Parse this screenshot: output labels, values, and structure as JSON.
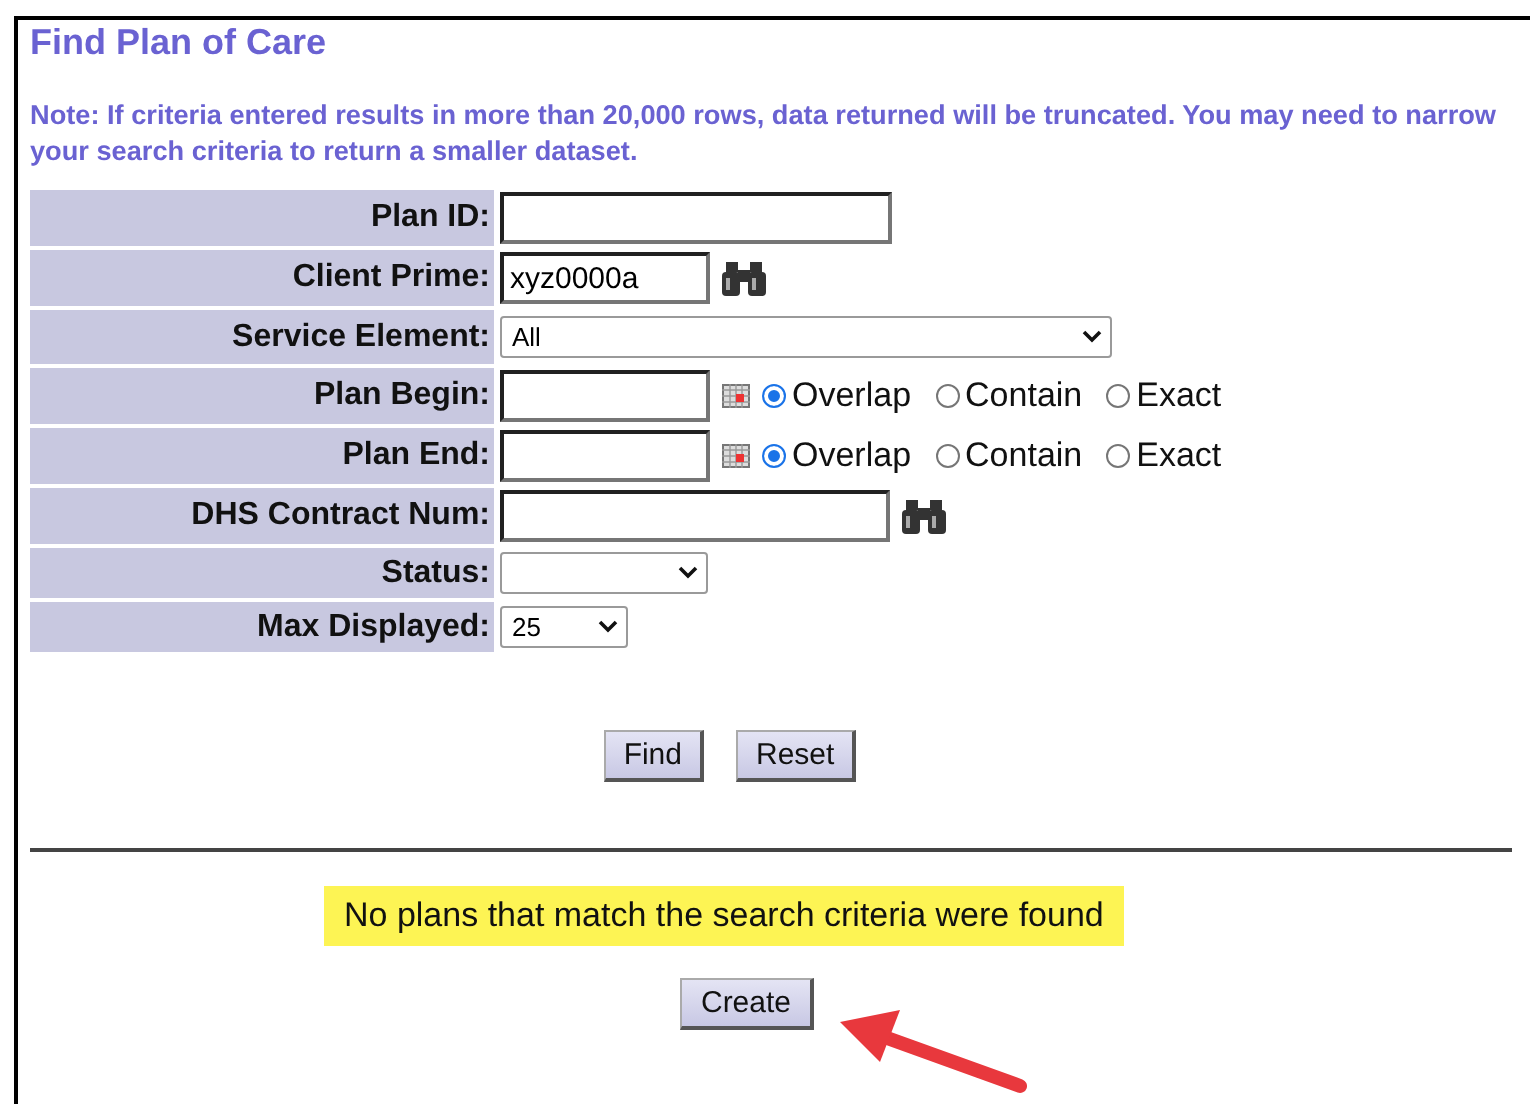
{
  "title": "Find Plan of Care",
  "note": "Note: If criteria entered results in more than 20,000 rows, data returned will be truncated. You may need to narrow your search criteria to return a smaller dataset.",
  "fields": [
    {
      "label": "Plan ID:",
      "kind": "text"
    },
    {
      "label": "Client Prime:",
      "kind": "lookup",
      "value": "xyz0000a"
    },
    {
      "label": "Service Element:",
      "kind": "select",
      "value": "All"
    },
    {
      "label": "Plan Begin:",
      "kind": "date",
      "options": [
        {
          "label": "Overlap",
          "selected": true
        },
        {
          "label": "Contain",
          "selected": false
        },
        {
          "label": "Exact",
          "selected": false
        }
      ]
    },
    {
      "label": "Plan End:",
      "kind": "date",
      "options": [
        {
          "label": "Overlap",
          "selected": true
        },
        {
          "label": "Contain",
          "selected": false
        },
        {
          "label": "Exact",
          "selected": false
        }
      ]
    },
    {
      "label": "DHS Contract Num:",
      "kind": "lookup"
    },
    {
      "label": "Status:",
      "kind": "select"
    },
    {
      "label": "Max Displayed:",
      "kind": "select",
      "value": "25"
    }
  ],
  "buttons": [
    "Find",
    "Reset"
  ],
  "message": "No plans that match the search criteria were found",
  "create_button": "Create"
}
